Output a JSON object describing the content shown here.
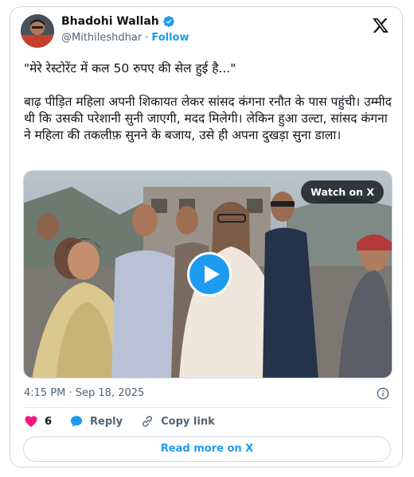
{
  "author": {
    "display_name": "Bhadohi Wallah",
    "handle": "@Mithileshdhar",
    "separator": "·",
    "follow_label": "Follow",
    "verified_color": "#1d9bf0"
  },
  "tweet": {
    "quote_line": "\"मेरे रेस्टोरेंट में कल 50 रुपए की सेल हुई है...\"",
    "body": "बाढ़ पीड़ित महिला अपनी शिकायत लेकर सांसद कंगना रनौत के पास पहुंची। उम्मीद थी कि उसकी परेशानी सुनी जाएगी, मदद मिलेगी। लेकिन हुआ उल्टा, सांसद कंगना ने महिला की तकलीफ़ सुनने के बजाय, उसे ही अपना दुखड़ा सुना डाला।",
    "timestamp": "4:15 PM · Sep 18, 2025"
  },
  "media": {
    "watch_label": "Watch on X",
    "play_icon": "play-icon"
  },
  "actions": {
    "like_count": "6",
    "reply_label": "Reply",
    "copy_link_label": "Copy link"
  },
  "footer": {
    "read_more_label": "Read more on X"
  },
  "colors": {
    "accent": "#1d9bf0",
    "like": "#f91880",
    "text": "#0f1419",
    "muted": "#536471"
  }
}
